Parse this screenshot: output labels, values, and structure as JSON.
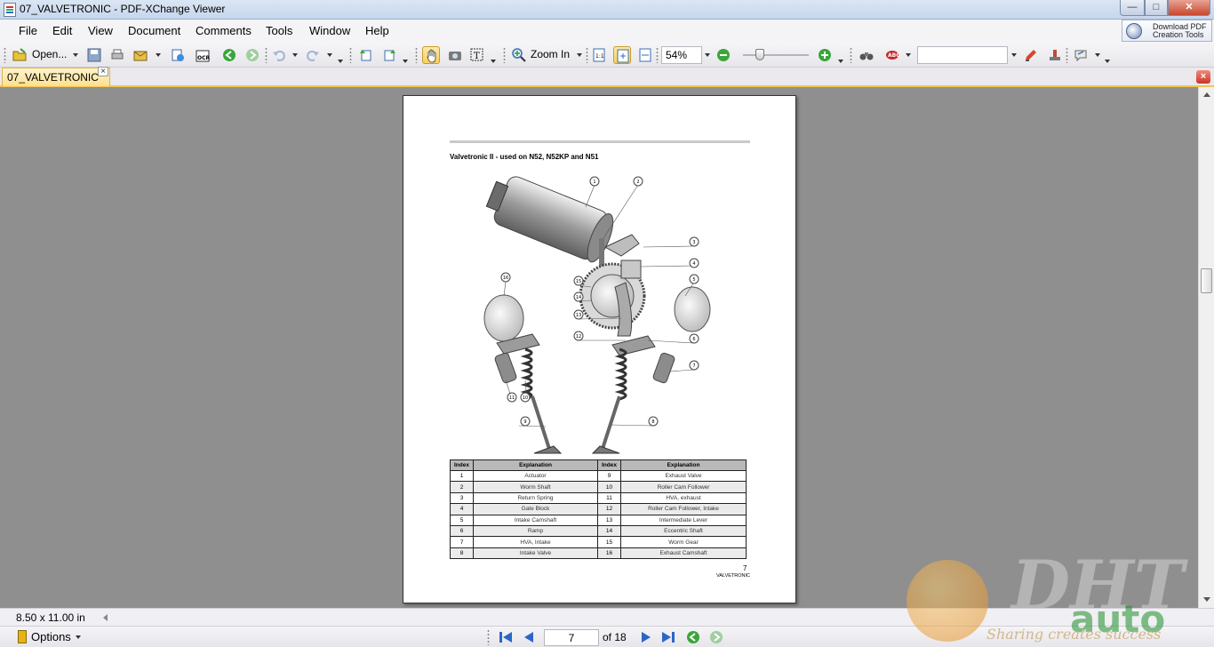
{
  "window": {
    "title": "07_VALVETRONIC - PDF-XChange Viewer",
    "controls": [
      "minimize",
      "maximize",
      "close"
    ]
  },
  "menu": {
    "items": [
      "File",
      "Edit",
      "View",
      "Document",
      "Comments",
      "Tools",
      "Window",
      "Help"
    ]
  },
  "promo": {
    "line1": "Download PDF",
    "line2": "Creation Tools"
  },
  "toolbar": {
    "open_label": "Open...",
    "zoom_in_label": "Zoom In",
    "zoom_value": "54%",
    "search_value": "",
    "icons": [
      "open-icon",
      "save-icon",
      "print-icon",
      "email-icon",
      "scan-icon",
      "ocr-icon",
      "back-icon",
      "forward-icon",
      "undo-icon",
      "redo-icon",
      "snapshot-icon",
      "hand-tool-icon",
      "camera-icon",
      "select-text-icon",
      "zoom-in-icon",
      "actual-size-icon",
      "fit-page-icon",
      "fit-width-icon",
      "zoom-out-icon",
      "zoom-plus-icon",
      "binoculars-icon",
      "spellcheck-icon",
      "highlight-icon",
      "stamp-icon",
      "comments-tool-icon"
    ]
  },
  "tabs": [
    {
      "label": "07_VALVETRONIC",
      "active": true
    }
  ],
  "document": {
    "heading": "Valvetronic II - used on N52, N52KP and N51",
    "diagram_callouts": [
      "1",
      "2",
      "3",
      "4",
      "5",
      "6",
      "7",
      "8",
      "9",
      "10",
      "11",
      "12",
      "13",
      "14",
      "15",
      "16"
    ],
    "table": {
      "headers": [
        "Index",
        "Explanation",
        "Index",
        "Explanation"
      ],
      "rows": [
        [
          "1",
          "Actuator",
          "9",
          "Exhaust Valve"
        ],
        [
          "2",
          "Worm Shaft",
          "10",
          "Roller Cam Follower"
        ],
        [
          "3",
          "Return Spring",
          "11",
          "HVA, exhaust"
        ],
        [
          "4",
          "Gate Block",
          "12",
          "Roller Cam Follower, Intake"
        ],
        [
          "5",
          "Intake Camshaft",
          "13",
          "Intermediate Lever"
        ],
        [
          "6",
          "Ramp",
          "14",
          "Eccentric Shaft"
        ],
        [
          "7",
          "HVA, Intake",
          "15",
          "Worm Gear"
        ],
        [
          "8",
          "Intake Valve",
          "16",
          "Exhaust Camshaft"
        ]
      ]
    },
    "page_number": "7",
    "footer": "VALVETRONIC"
  },
  "status": {
    "dimensions": "8.50 x 11.00 in"
  },
  "navigation": {
    "options_label": "Options",
    "current_page": "7",
    "total_pages": "of 18"
  },
  "watermark": {
    "brand": "DHT",
    "sub": "auto",
    "tagline": "Sharing creates success"
  },
  "colors": {
    "tab_active": "#fbe08d",
    "viewport_bg": "#8f8f8f",
    "nav_blue": "#2a66c8",
    "nav_green": "#3aa63a"
  }
}
